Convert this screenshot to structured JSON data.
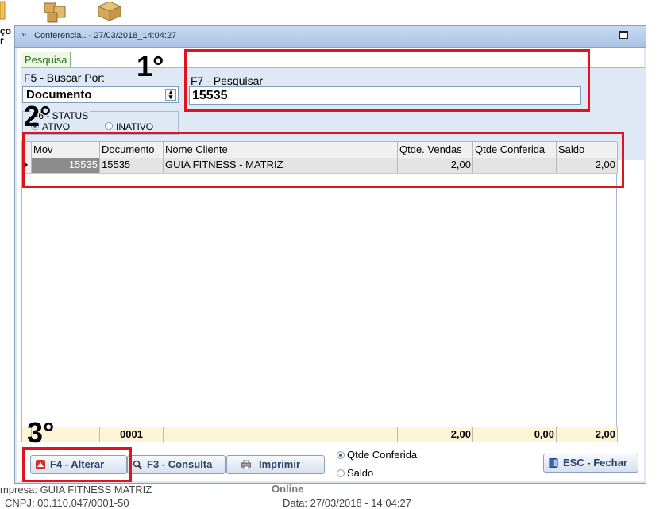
{
  "desktop": {
    "icon_label_top": "ço",
    "icon_label_bottom": "r"
  },
  "window": {
    "title": "Conferencia.. - 27/03/2018_14:04:27",
    "tab": "Pesquisa"
  },
  "filters": {
    "search_by_label": "F5 - Buscar Por:",
    "search_by_value": "Documento",
    "search_label": "F7 - Pesquisar",
    "search_value": "15535",
    "status_group_label": "F6 - STATUS",
    "status_active": "ATIVO",
    "status_inactive": "INATIVO",
    "status_selected": "ATIVO"
  },
  "grid": {
    "columns": [
      "Mov",
      "Documento",
      "Nome Cliente",
      "Qtde. Vendas",
      "Qtde Conferida",
      "Saldo"
    ],
    "rows": [
      {
        "mov": "15535",
        "documento": "15535",
        "nome_cliente": "GUIA FITNESS - MATRIZ",
        "qtde_vendas": "2,00",
        "qtde_conferida": "",
        "saldo": "2,00"
      }
    ],
    "footer": {
      "documento": "0001",
      "qtde_vendas": "2,00",
      "qtde_conferida": "0,00",
      "saldo": "2,00"
    }
  },
  "buttons": {
    "alterar": "F4 - Alterar",
    "consulta": "F3 - Consulta",
    "imprimir": "Imprimir",
    "fechar": "ESC - Fechar"
  },
  "print_options": {
    "qtde_conferida": "Qtde Conferida",
    "saldo": "Saldo",
    "selected": "Qtde Conferida"
  },
  "annotations": {
    "mark1": "1°",
    "mark2": "2°",
    "mark3": "3°"
  },
  "background_text": {
    "empresa": "mpresa: GUIA FITNESS MATRIZ",
    "online": "Online",
    "line2_left": "CNPJ: 00.110.047/0001-50",
    "line2_right": "Data: 27/03/2018 - 14:04:27"
  },
  "colors": {
    "annotation_red": "#e0141e",
    "window_bg": "#dfe8f5",
    "footer_bg": "#fdf5d5",
    "tab_green": "#2e6b2e"
  }
}
